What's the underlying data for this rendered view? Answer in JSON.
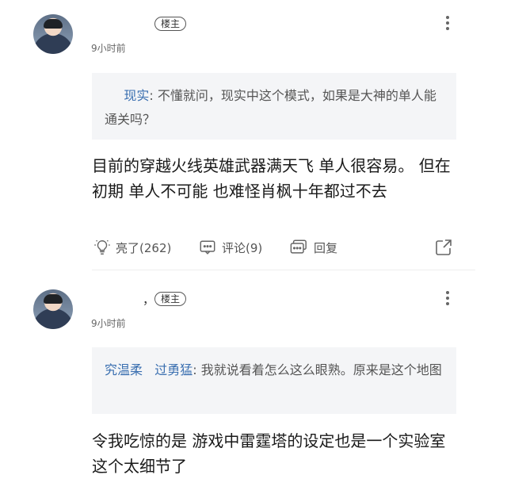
{
  "posts": [
    {
      "username": "",
      "badge": "楼主",
      "timestamp": "9小时前",
      "quote": {
        "name": "现实",
        "separator": ": ",
        "text": "不懂就问，现实中这个模式，如果是大神的单人能通关吗？"
      },
      "body": [
        "目前的穿越火线英雄武器满天飞 单人很容易。 但在",
        "初期 单人不可能 也难怪肖枫十年都过不去"
      ],
      "actions": {
        "like": "亮了(262)",
        "comment": "评论(9)",
        "reply": "回复"
      }
    },
    {
      "username": "，",
      "badge": "楼主",
      "timestamp": "9小时前",
      "quote": {
        "name_prefix": "究温柔",
        "name": "过勇猛",
        "separator": ": ",
        "text": "我就说看着怎么这么眼熟。原来是这个地图"
      },
      "body": [
        "令我吃惊的是 游戏中雷霆塔的设定也是一个实验室",
        "这个太细节了"
      ]
    }
  ],
  "icons": {
    "more": "more-vertical-icon",
    "like": "lightbulb-icon",
    "comment": "comment-bubble-icon",
    "reply": "reply-bubble-icon",
    "share": "share-icon"
  },
  "colors": {
    "quote_bg": "#f4f5f7",
    "quote_name": "#3a6fb0",
    "text": "#1a1a1a",
    "muted": "#555555"
  }
}
